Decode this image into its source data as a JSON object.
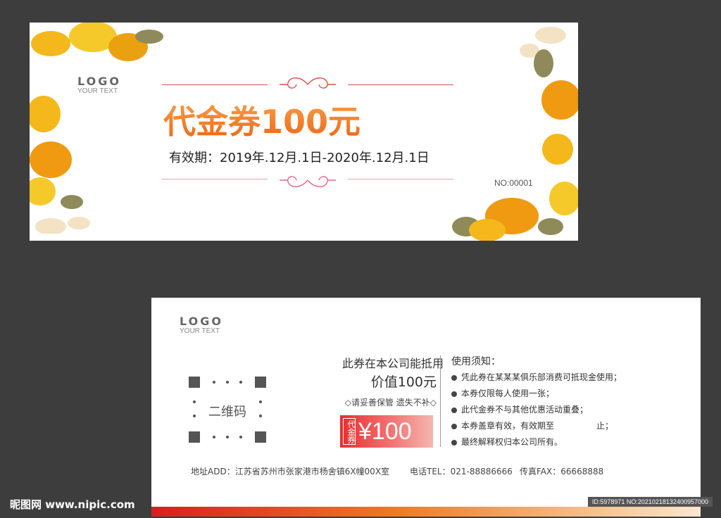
{
  "front": {
    "logo_mark": "LOGO",
    "logo_sub": "YOUR TEXT",
    "title": "代金券100元",
    "validity": "有效期：2019年.12月.1日-2020年.12月.1日",
    "serial": "NO:00001"
  },
  "back": {
    "logo_mark": "LOGO",
    "logo_sub": "YOUR TEXT",
    "qr_label": "二维码",
    "use_line1": "此券在本公司能抵用",
    "use_line2": "价值100元",
    "keep_note": "◇请妥善保管 遗失不补◇",
    "badge_tag": "代金券",
    "badge_amount": "¥100",
    "rules_title": "使用须知：",
    "rules": [
      "凭此券在某某某俱乐部消费可抵现金使用；",
      "本券仅限每人使用一张；",
      "此代金券不与其他优惠活动重叠；",
      "本券盖章有效，有效期至　　　　　止；",
      "最终解释权归本公司所有。"
    ],
    "address": "地址ADD：江苏省苏州市张家港市杨舍镇6X幢00X室",
    "phone": "电话TEL：021-88886666",
    "fax": "传真FAX：66668888"
  },
  "watermark": "昵图网 www.nipic.com",
  "image_id": "ID:5978971 NO:20210218132400957000",
  "colors": {
    "accent": "#f2711f",
    "red": "#ea2d2d",
    "background": "#3d3d3d"
  }
}
